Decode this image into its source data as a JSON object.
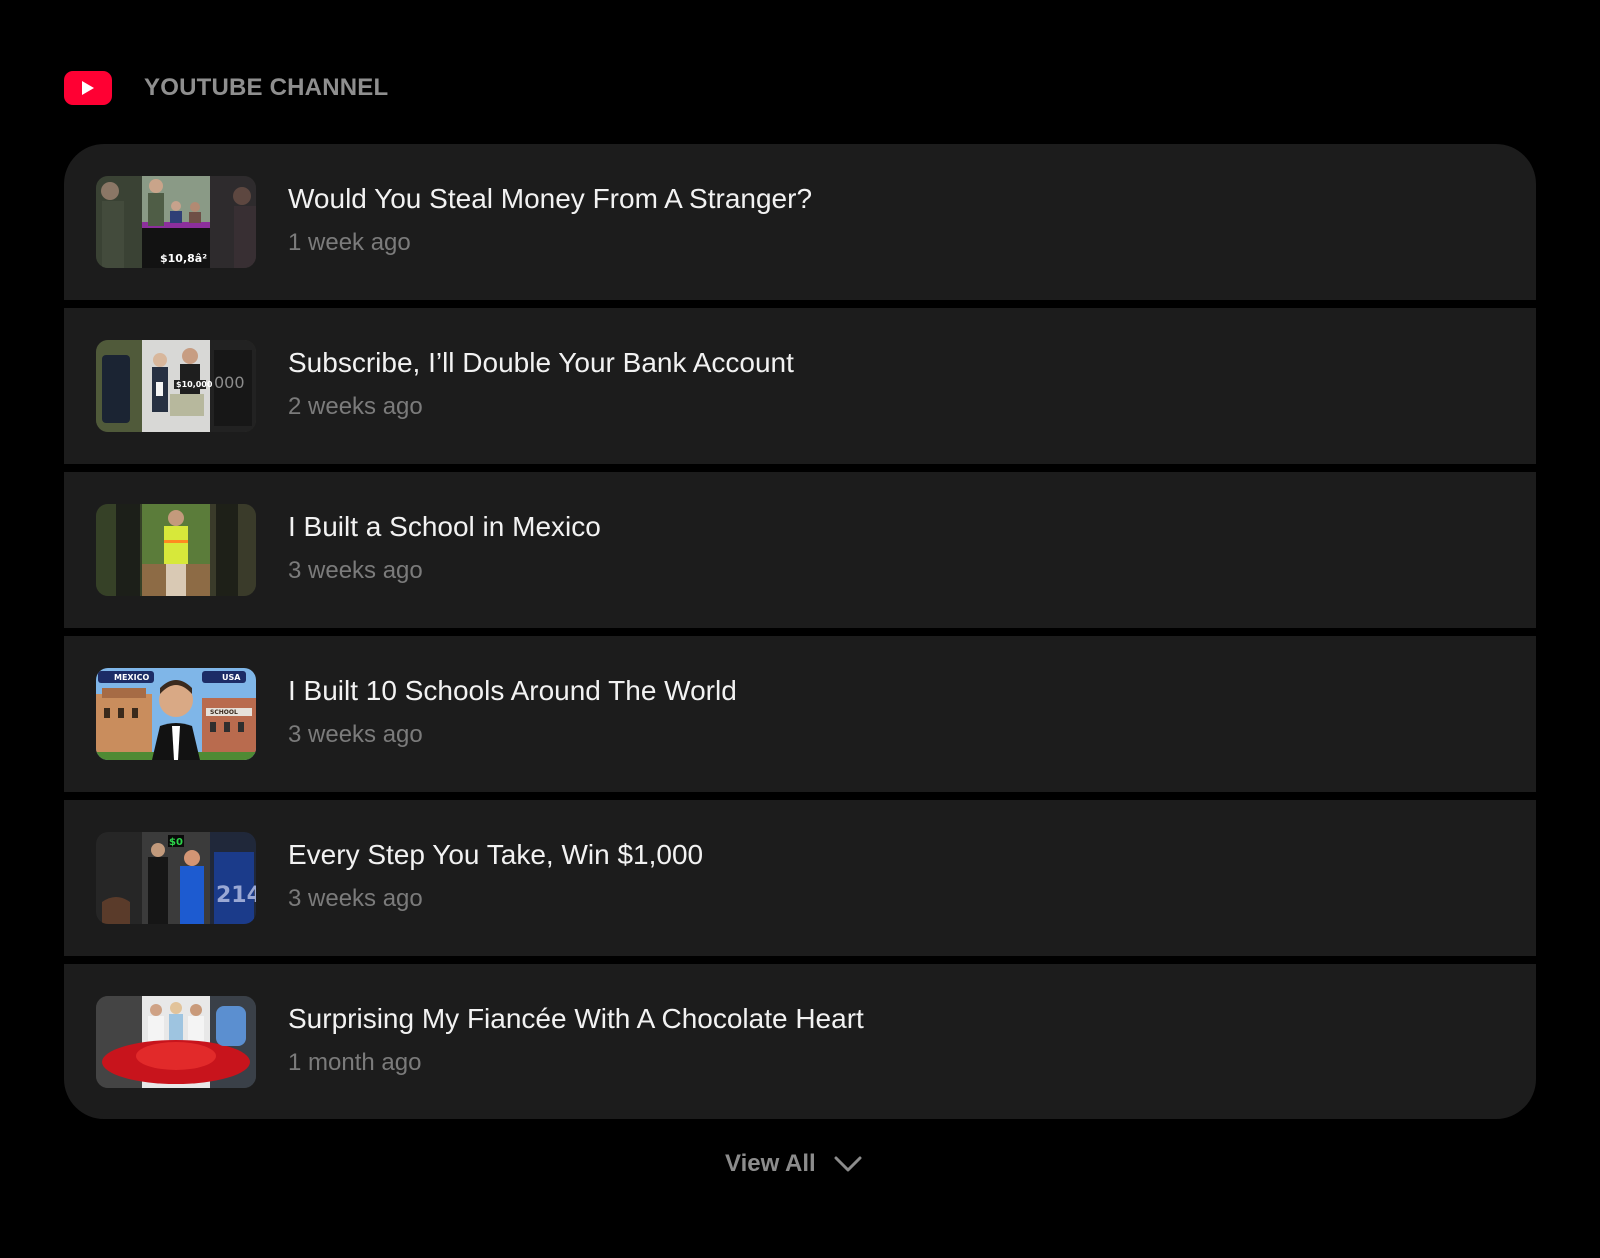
{
  "header": {
    "logo_icon": "youtube-play-icon",
    "title": "YOUTUBE CHANNEL",
    "logo_color": "#ff0033"
  },
  "videos": [
    {
      "title": "Would You Steal Money From A Stranger?",
      "age": "1 week ago",
      "thumb_text": "$10,8â²"
    },
    {
      "title": "Subscribe, I’ll Double Your Bank Account",
      "age": "2 weeks ago",
      "thumb_text": "$10,000"
    },
    {
      "title": "I Built a School in Mexico",
      "age": "3 weeks ago",
      "thumb_text": ""
    },
    {
      "title": "I Built 10 Schools Around The World",
      "age": "3 weeks ago",
      "thumb_text": "MEXICO",
      "thumb_text2": "USA",
      "thumb_text3": "SCHOOL"
    },
    {
      "title": "Every Step You Take, Win $1,000",
      "age": "3 weeks ago",
      "thumb_text": "$0",
      "thumb_text2": "214"
    },
    {
      "title": "Surprising My Fiancée With A Chocolate Heart",
      "age": "1 month ago",
      "thumb_text": ""
    }
  ],
  "footer": {
    "view_all_label": "View All",
    "view_all_icon": "chevron-down-icon"
  },
  "colors": {
    "background": "#000000",
    "card": "#1c1c1c",
    "title_text": "#f2f2f2",
    "meta_text": "#7b7b7b"
  }
}
